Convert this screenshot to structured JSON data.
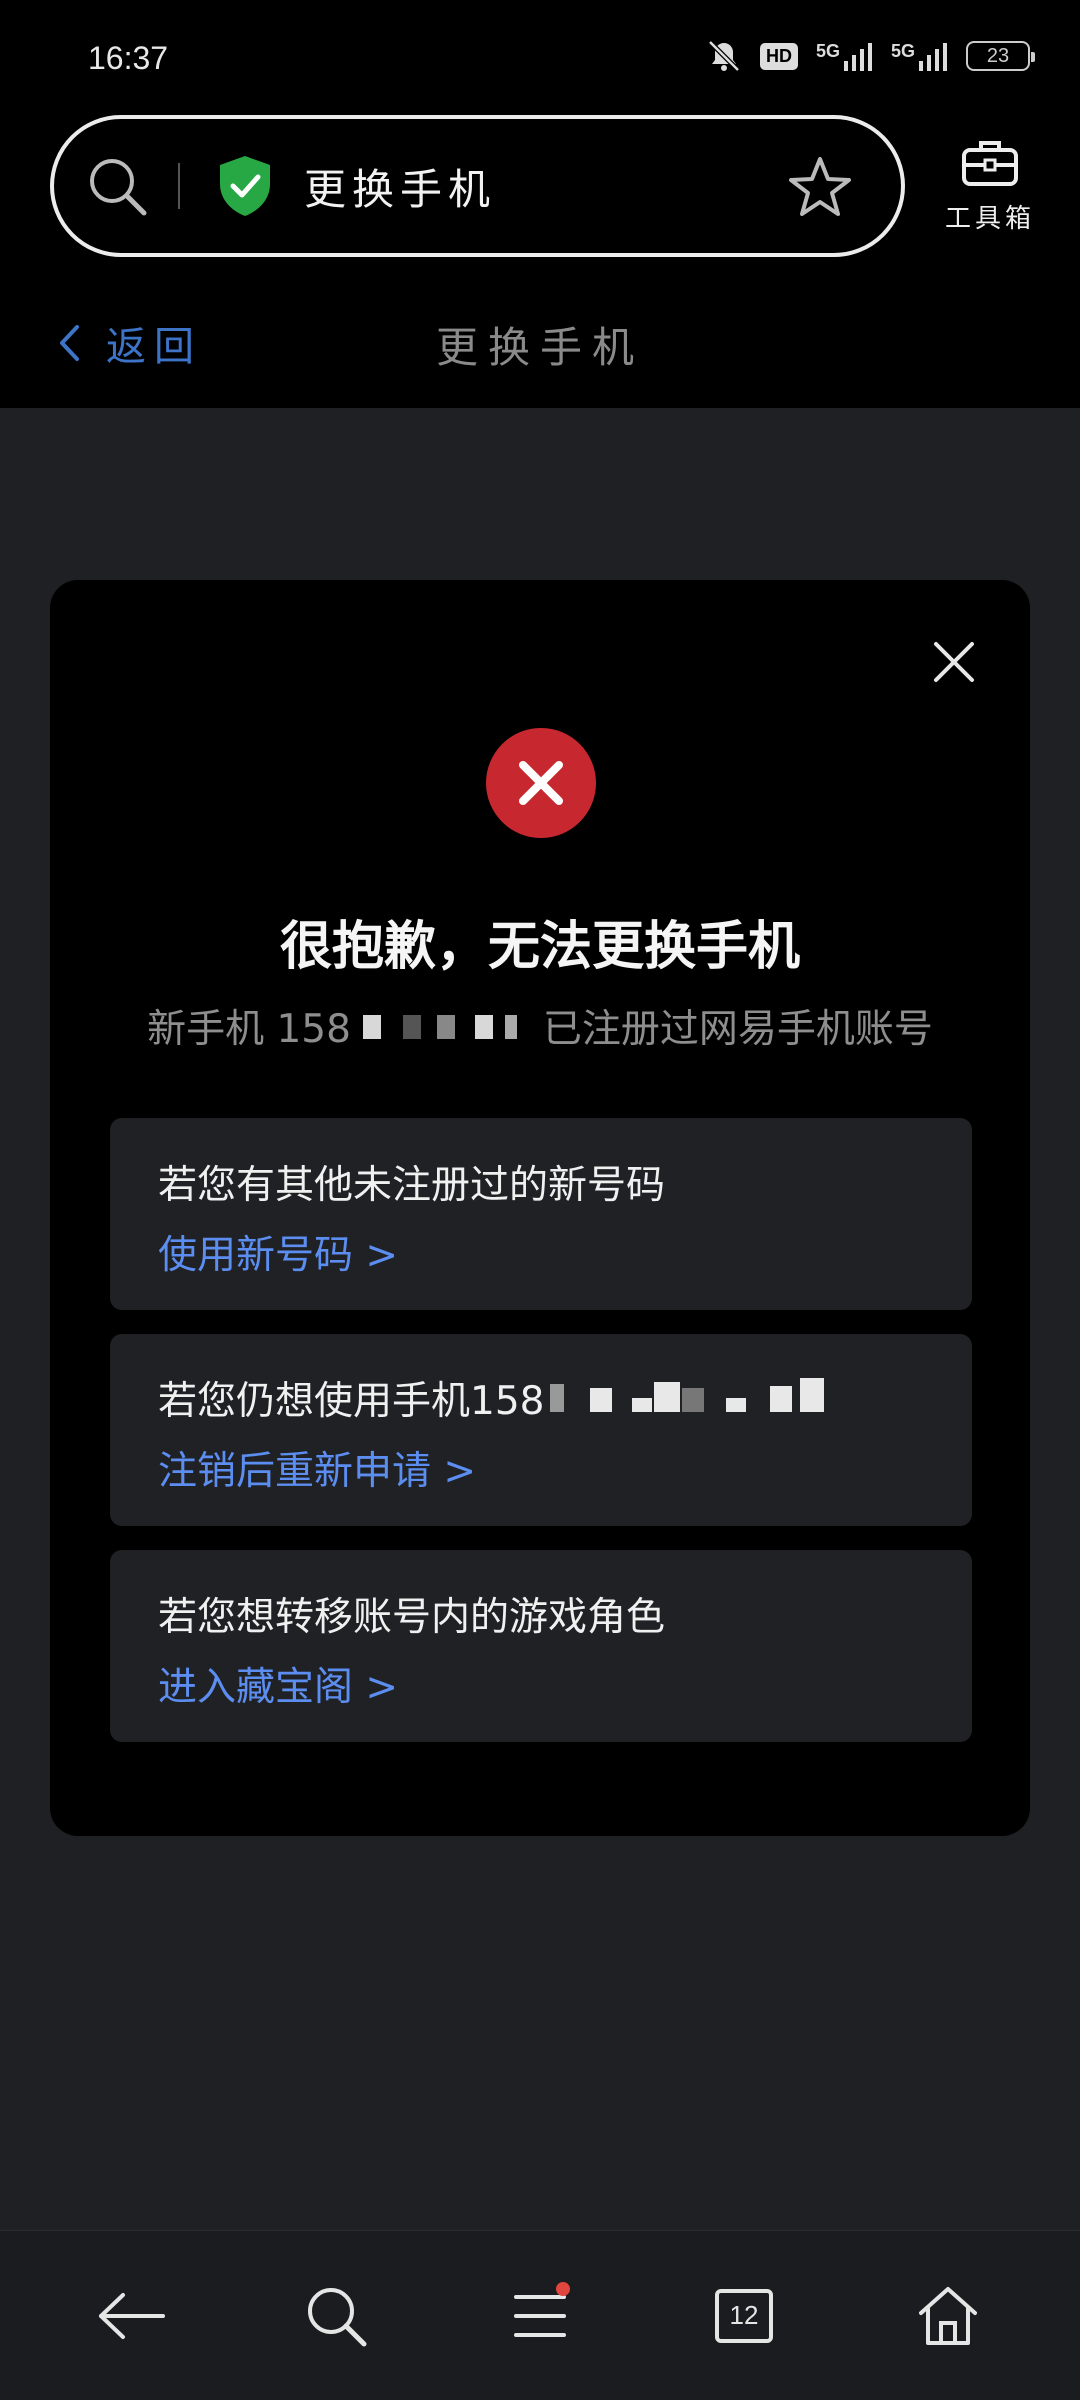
{
  "status_bar": {
    "time": "16:37",
    "network_1": "5G",
    "network_2": "5G",
    "hd_badge": "HD",
    "battery": "23"
  },
  "browser": {
    "address_title": "更换手机",
    "toolbox_label": "工具箱"
  },
  "page_nav": {
    "back_label": "返回",
    "title": "更换手机"
  },
  "dialog": {
    "headline": "很抱歉，无法更换手机",
    "message_prefix": "新手机 158",
    "message_suffix": "已注册过网易手机账号",
    "options": [
      {
        "question": "若您有其他未注册过的新号码",
        "action": "使用新号码 >"
      },
      {
        "question": "若您仍想使用手机158",
        "action": "注销后重新申请 >"
      },
      {
        "question": "若您想转移账号内的游戏角色",
        "action": "进入藏宝阁 >"
      }
    ]
  },
  "bottom_nav": {
    "tab_count": "12"
  },
  "colors": {
    "background": "#1f2024",
    "link_blue": "#5c8df0",
    "back_blue": "#3d74c8",
    "error_red": "#c7282f",
    "shield_green": "#27a844"
  }
}
